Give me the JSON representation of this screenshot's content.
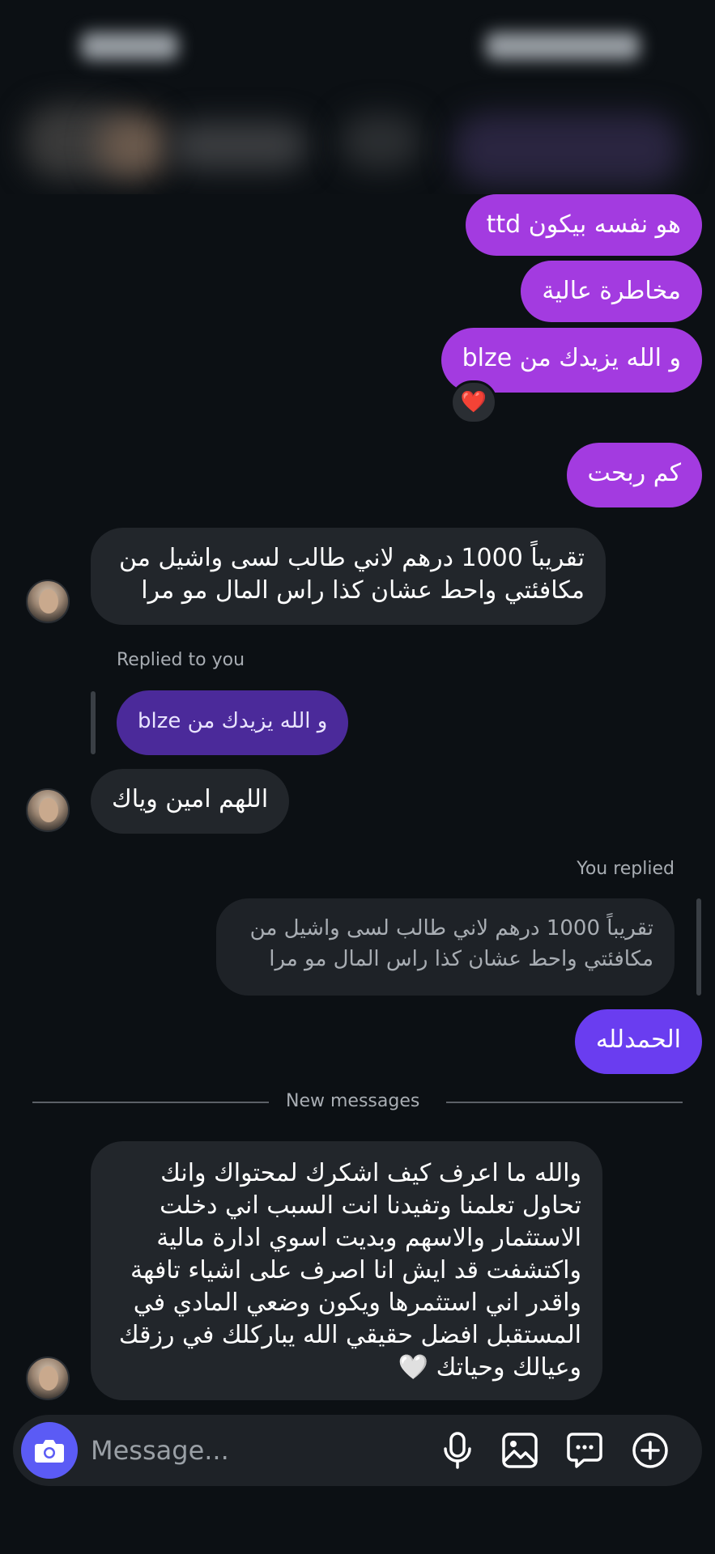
{
  "messages": {
    "out1": "هو نفسه بيكون ttd",
    "out2": "مخاطرة عالية",
    "out3": "و الله يزيدك من blze",
    "out3_reaction": "❤️",
    "out4": "كم ربحت",
    "in1_line1": "تقريباً 1000 درهم لاني طالب لسى واشيل من",
    "in1_line2": "مكافئتي واحط عشان كذا راس المال مو مرا",
    "replied_to_you_label": "Replied to you",
    "in2_quote": "و الله يزيدك من blze",
    "in2": "اللهم امين وياك",
    "you_replied_label": "You replied",
    "out5_quote_line1": "تقريباً 1000 درهم لاني طالب لسى واشيل من",
    "out5_quote_line2": "مكافئتي واحط عشان كذا راس المال مو مرا",
    "out5": "الحمدلله",
    "new_messages_label": "New messages",
    "in3_lines": [
      "والله ما اعرف كيف اشكرك لمحتواك وانك",
      "تحاول تعلمنا وتفيدنا انت السبب اني دخلت",
      "الاستثمار والاسهم وبديت اسوي ادارة مالية",
      "واكتشفت قد ايش انا اصرف على اشياء تافهة",
      "واقدر اني استثمرها ويكون وضعي المادي في",
      "المستقبل افضل حقيقي الله يباركلك في رزقك",
      "وعيالك وحياتك 🤍"
    ]
  },
  "composer": {
    "placeholder": "Message...",
    "icons": [
      "camera-icon",
      "microphone-icon",
      "gallery-icon",
      "sticker-icon",
      "plus-icon"
    ]
  },
  "colors": {
    "background": "#0c1014",
    "outgoing": "#a33be0",
    "outgoing_latest": "#6a3df0",
    "incoming": "#22262b",
    "camera_button": "#5b5bf5"
  }
}
